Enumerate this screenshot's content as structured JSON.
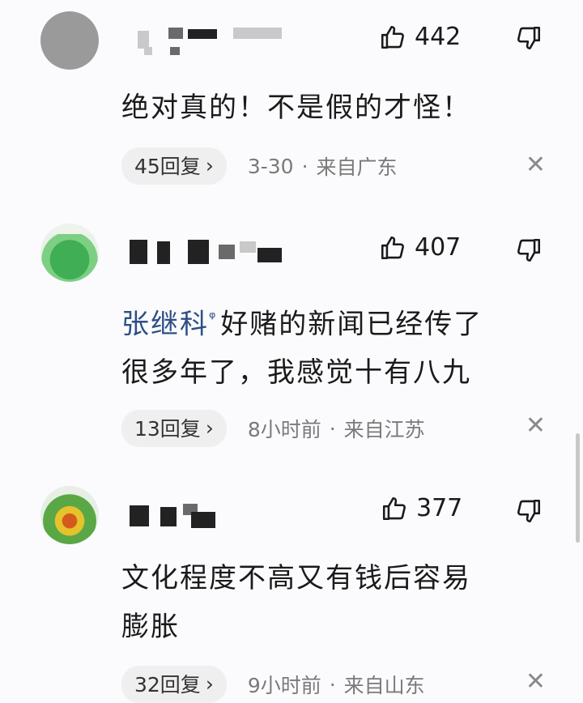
{
  "comments": [
    {
      "likes": "442",
      "text": "绝对真的！不是假的才怪！",
      "replies": "45回复",
      "time": "3-30",
      "location": "来自广东"
    },
    {
      "likes": "407",
      "mention": "张继科",
      "text_line1": "好赌的新闻已经传了",
      "text_line2": "很多年了，我感觉十有八九",
      "replies": "13回复",
      "time": "8小时前",
      "location": "来自江苏"
    },
    {
      "likes": "377",
      "text_line1": "文化程度不高又有钱后容易",
      "text_line2": "膨胀",
      "replies": "32回复",
      "time": "9小时前",
      "location": "来自山东"
    }
  ],
  "icons": {
    "like": "thumbs-up-icon",
    "dislike": "thumbs-down-icon",
    "close": "close-icon",
    "chevron": "chevron-right-icon",
    "mention": "search-link-icon"
  },
  "separator": "·",
  "chevron_glyph": "›",
  "close_glyph": "✕",
  "mention_glyph": "ᵠ"
}
